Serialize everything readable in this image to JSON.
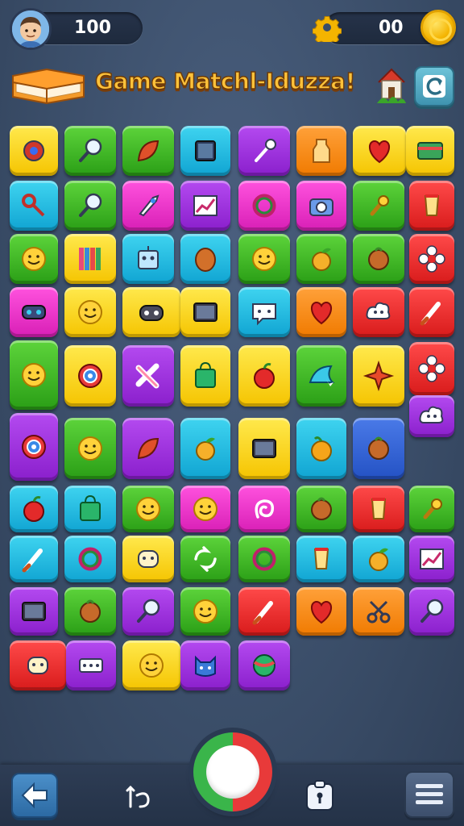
{
  "header": {
    "score": "100",
    "coins": "00",
    "title": "Game Matchl-Iduzza!"
  },
  "icons": {
    "avatar": "avatar-face-icon",
    "settings": "gear-icon",
    "currency": "coin-icon",
    "logo": "book-icon",
    "home": "house-icon",
    "refresh": "refresh-icon",
    "back": "arrow-left-icon",
    "undo": "undo-icon",
    "play": "record-button-icon",
    "hint": "lock-icon",
    "menu": "menu-icon"
  },
  "colors": {
    "background": "#3a4d68",
    "title": "#ffc23a",
    "yellow": "#f5c400",
    "green": "#2a9e16",
    "cyan": "#10a4d2",
    "purple": "#8a1fcc",
    "orange": "#f07a00",
    "red": "#d81b1b",
    "magenta": "#d81fb6"
  },
  "board": {
    "tiles": [
      {
        "color": "yellow",
        "icon": "gear-icon"
      },
      {
        "color": "green",
        "icon": "magnifier-icon"
      },
      {
        "color": "green",
        "icon": "leaf-icon"
      },
      {
        "color": "cyan",
        "icon": "square-icon"
      },
      {
        "color": "purple",
        "icon": "wand-icon"
      },
      {
        "color": "orange",
        "icon": "bottle-icon"
      },
      {
        "color": "yellow",
        "icon": "heart-icon"
      },
      {
        "color": "yellow",
        "icon": "card-icon"
      },
      {
        "color": "cyan",
        "icon": "key-icon"
      },
      {
        "color": "green",
        "icon": "magnifier-icon"
      },
      {
        "color": "magenta",
        "icon": "rocket-icon"
      },
      {
        "color": "purple",
        "icon": "chart-icon"
      },
      {
        "color": "magenta",
        "icon": "ring-icon"
      },
      {
        "color": "magenta",
        "icon": "camera-icon"
      },
      {
        "color": "green",
        "icon": "plug-icon"
      },
      {
        "color": "red",
        "icon": "cup-icon"
      },
      {
        "color": "green",
        "icon": "smiley-icon"
      },
      {
        "color": "yellow",
        "icon": "books-icon"
      },
      {
        "color": "cyan",
        "icon": "robot-icon"
      },
      {
        "color": "cyan",
        "icon": "egg-icon"
      },
      {
        "color": "green",
        "icon": "smiley-icon"
      },
      {
        "color": "green",
        "icon": "fruit-icon"
      },
      {
        "color": "green",
        "icon": "nut-icon"
      },
      {
        "color": "red",
        "icon": "flower-icon"
      },
      {
        "color": "magenta",
        "icon": "mask-icon"
      },
      {
        "color": "yellow",
        "icon": "smiley-icon"
      },
      {
        "color": "yellow",
        "icon": "gamepad-icon"
      },
      {
        "color": "yellow",
        "icon": "tv-icon"
      },
      {
        "color": "cyan",
        "icon": "chat-icon"
      },
      {
        "color": "orange",
        "icon": "heart-icon"
      },
      {
        "color": "red",
        "icon": "cloud-icon"
      },
      {
        "color": "red",
        "icon": "brush-icon"
      },
      {
        "color": "green",
        "icon": "smiley-icon"
      },
      {
        "color": "yellow",
        "icon": "target-icon"
      },
      {
        "color": "purple",
        "icon": "cross-icon"
      },
      {
        "color": "yellow",
        "icon": "bag-icon"
      },
      {
        "color": "yellow",
        "icon": "apple-icon"
      },
      {
        "color": "green",
        "icon": "bird-icon"
      },
      {
        "color": "yellow",
        "icon": "star-icon"
      },
      {
        "color": "red",
        "icon": "flower-icon"
      },
      {
        "color": "purple",
        "icon": "target-icon"
      },
      {
        "color": "green",
        "icon": "smiley-icon"
      },
      {
        "color": "purple",
        "icon": "leaf-icon"
      },
      {
        "color": "cyan",
        "icon": "fruit-icon"
      },
      {
        "color": "yellow",
        "icon": "tv-icon"
      },
      {
        "color": "cyan",
        "icon": "orange-icon"
      },
      {
        "color": "blue",
        "icon": "nut-icon"
      },
      {
        "color": "purple",
        "icon": "cloud-icon"
      },
      {
        "color": "cyan",
        "icon": "apple-icon"
      },
      {
        "color": "cyan",
        "icon": "bag-icon"
      },
      {
        "color": "green",
        "icon": "smiley-icon"
      },
      {
        "color": "magenta",
        "icon": "smiley-icon"
      },
      {
        "color": "magenta",
        "icon": "spiral-icon"
      },
      {
        "color": "green",
        "icon": "nut-icon"
      },
      {
        "color": "red",
        "icon": "cup-icon"
      },
      {
        "color": "green",
        "icon": "plug-icon"
      },
      {
        "color": "cyan",
        "icon": "brush-icon"
      },
      {
        "color": "cyan",
        "icon": "ring-icon"
      },
      {
        "color": "yellow",
        "icon": "face-icon"
      },
      {
        "color": "green",
        "icon": "recycle-icon"
      },
      {
        "color": "green",
        "icon": "ring-icon"
      },
      {
        "color": "cyan",
        "icon": "cup-icon"
      },
      {
        "color": "cyan",
        "icon": "fruit-icon"
      },
      {
        "color": "purple",
        "icon": "chart-icon"
      },
      {
        "color": "purple",
        "icon": "tv-icon"
      },
      {
        "color": "green",
        "icon": "nut-icon"
      },
      {
        "color": "purple",
        "icon": "magnifier-icon"
      },
      {
        "color": "green",
        "icon": "smiley-icon"
      },
      {
        "color": "red",
        "icon": "brush-icon"
      },
      {
        "color": "orange",
        "icon": "heart-icon"
      },
      {
        "color": "orange",
        "icon": "scissors-icon"
      },
      {
        "color": "purple",
        "icon": "magnifier-icon"
      },
      {
        "color": "red",
        "icon": "face-icon"
      },
      {
        "color": "purple",
        "icon": "domino-icon"
      },
      {
        "color": "yellow",
        "icon": "smiley-icon"
      },
      {
        "color": "purple",
        "icon": "cat-icon"
      },
      {
        "color": "purple",
        "icon": "ball-icon"
      }
    ]
  }
}
